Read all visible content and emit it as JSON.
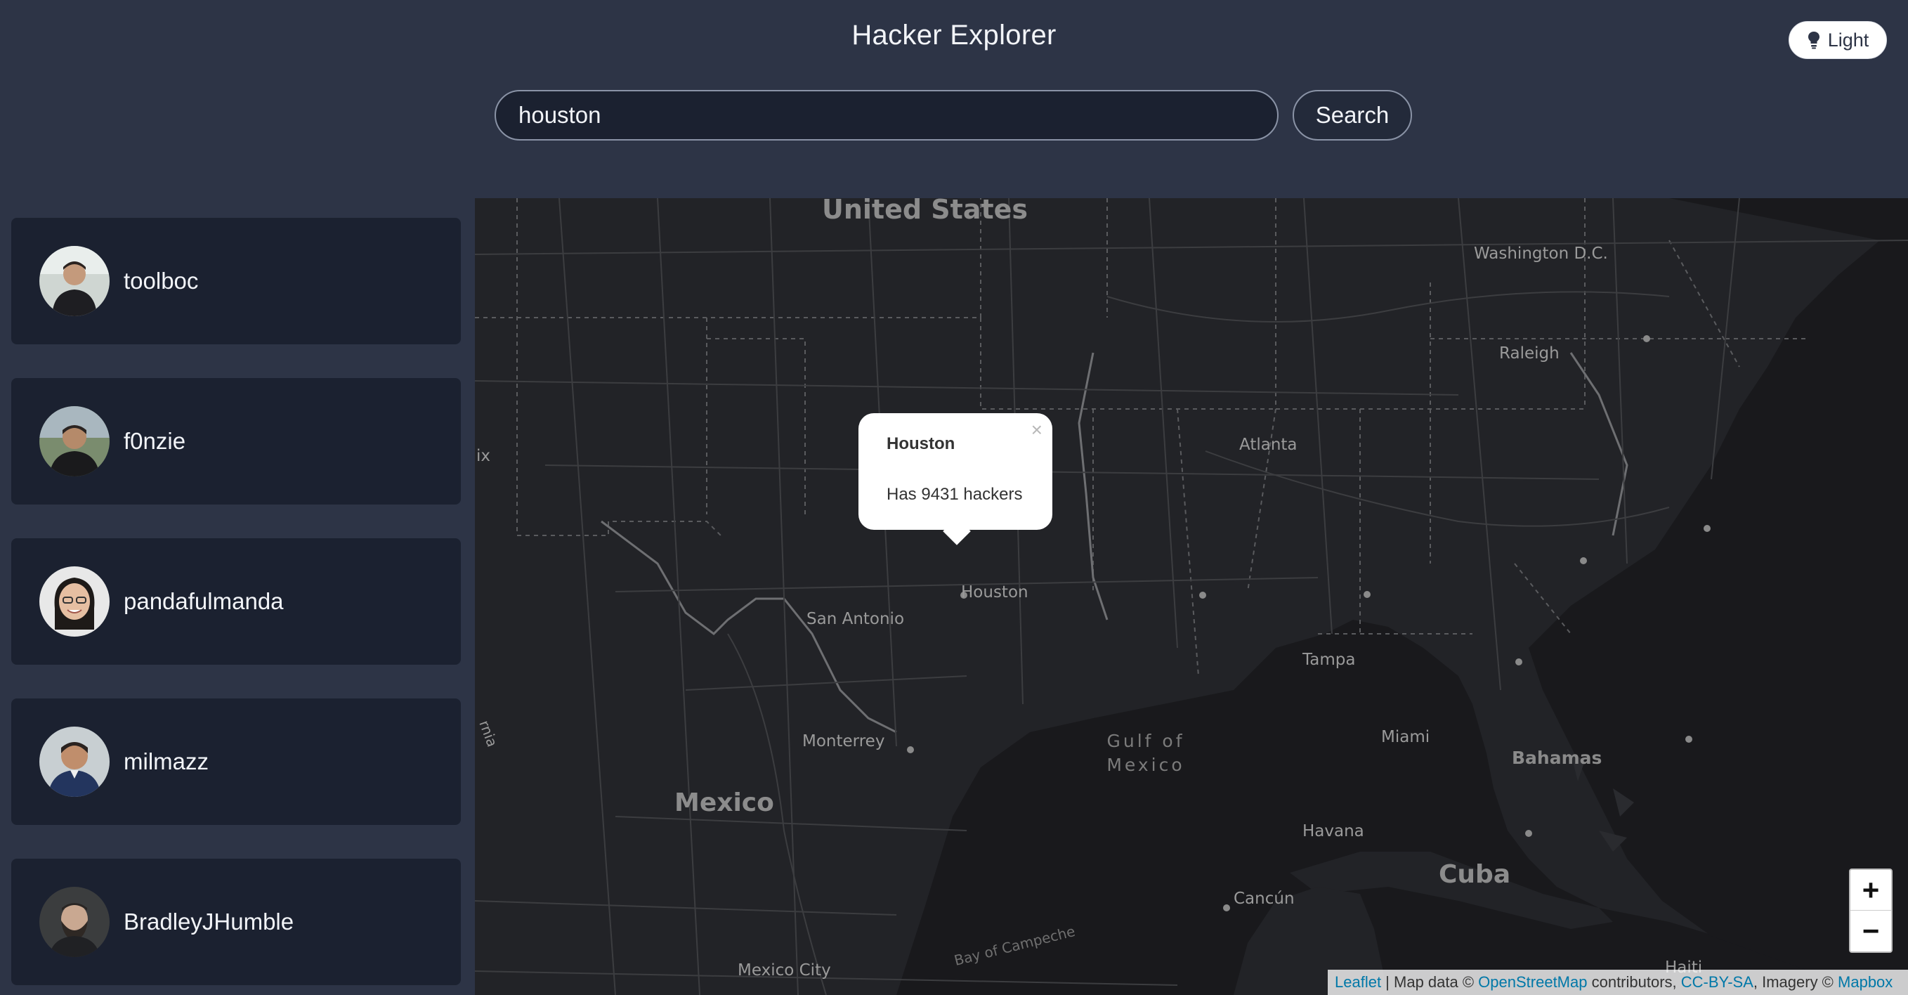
{
  "header": {
    "title": "Hacker Explorer"
  },
  "theme_toggle": {
    "label": "Light",
    "icon": "lightbulb-icon"
  },
  "search": {
    "value": "houston",
    "button_label": "Search"
  },
  "users": [
    {
      "username": "toolboc"
    },
    {
      "username": "f0nzie"
    },
    {
      "username": "pandafulmanda"
    },
    {
      "username": "milmazz"
    },
    {
      "username": "BradleyJHumble"
    }
  ],
  "map": {
    "labels": {
      "united_states": "United States",
      "washington": "Washington D.C.",
      "raleigh": "Raleigh",
      "atlanta": "Atlanta",
      "houston": "Houston",
      "san_antonio": "San Antonio",
      "tampa": "Tampa",
      "miami": "Miami",
      "bahamas": "Bahamas",
      "gulf": "Gulf of Mexico",
      "monterrey": "Monterrey",
      "mexico": "Mexico",
      "havana": "Havana",
      "cuba": "Cuba",
      "cancun": "Cancún",
      "bay_campeche": "Bay of Campeche",
      "mexico_city": "Mexico City",
      "haiti": "Haiti",
      "ix": "ix",
      "rnia": "rnia"
    },
    "popup": {
      "title": "Houston",
      "text": "Has 9431 hackers",
      "close": "×"
    },
    "zoom": {
      "in": "+",
      "out": "−"
    },
    "attribution": {
      "leaflet": "Leaflet",
      "sep": " | Map data © ",
      "osm": "OpenStreetMap",
      "contrib": " contributors, ",
      "cc": "CC-BY-SA",
      "imagery": ", Imagery © ",
      "mapbox": "Mapbox"
    }
  },
  "colors": {
    "page_bg": "#2d3446",
    "card_bg": "#1b2130",
    "map_land": "#222327",
    "map_water": "#191a1d",
    "link": "#0078a8"
  }
}
